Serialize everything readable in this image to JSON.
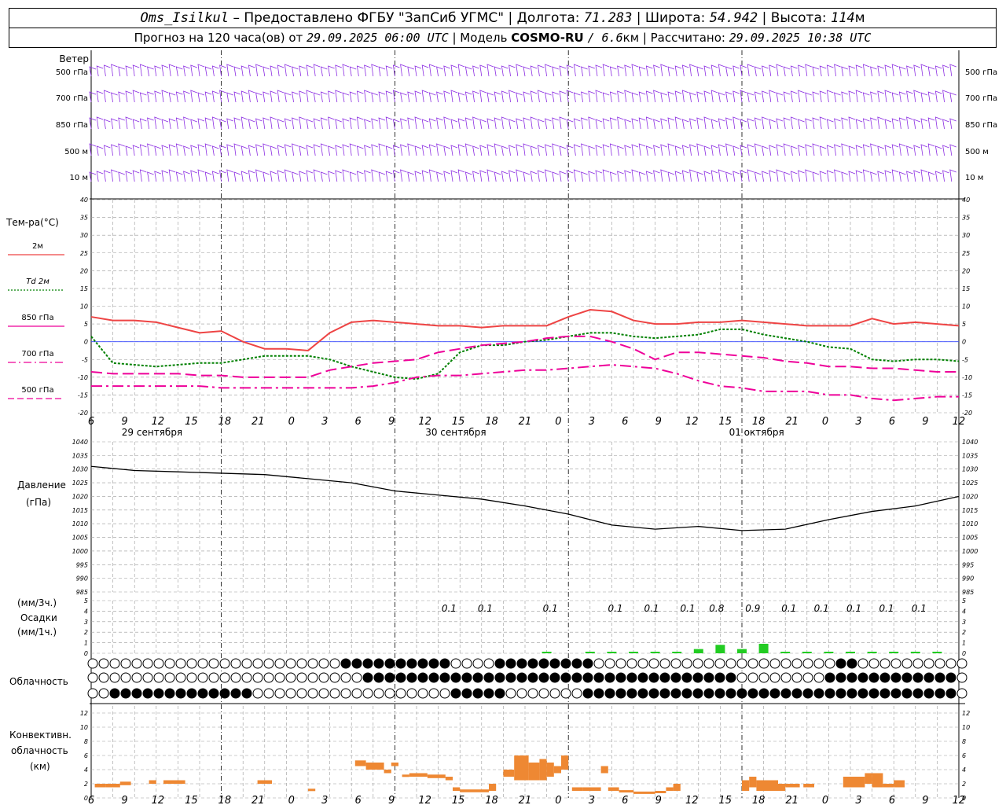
{
  "header": {
    "station": "Oms_Isilkul",
    "provided_by": "– Предоставлено ФГБУ \"ЗапСиб УГМС\"",
    "lon_label": "| Долгота:",
    "lon": "71.283",
    "lat_label": "| Широта:",
    "lat": "54.942",
    "alt_label": "| Высота:",
    "alt": "114",
    "alt_unit": "м",
    "forecast_label": "Прогноз на 120 часа(ов) от",
    "forecast_start": "29.09.2025 06:00 UTC",
    "model_label": "| Модель",
    "model": "COSMO-RU",
    "resolution": "/ 6.6",
    "res_unit": "км",
    "calc_label": "| Рассчитано:",
    "calc_time": "29.09.2025 10:38 UTC"
  },
  "wind": {
    "title": "Ветер",
    "levels": [
      "500 гПа",
      "700 гПа",
      "850 гПа",
      "500 м",
      "10 м"
    ],
    "color": "#8a2be2"
  },
  "temperature": {
    "title": "Тем-ра(°C)",
    "legend": [
      {
        "label": "2м",
        "color": "#ee4444",
        "style": "solid"
      },
      {
        "label": "Td 2м",
        "color": "#008000",
        "style": "dotted"
      },
      {
        "label": "850 гПа",
        "color": "#ee0099",
        "style": "solid"
      },
      {
        "label": "700 гПа",
        "color": "#ee0099",
        "style": "dashdot"
      },
      {
        "label": "500 гПа",
        "color": "#ee0099",
        "style": "dashed"
      }
    ],
    "y_ticks": [
      "40",
      "35",
      "30",
      "25",
      "20",
      "15",
      "10",
      "5",
      "0",
      "-5",
      "-10",
      "-15",
      "-20"
    ]
  },
  "time_axis": {
    "hour_labels": [
      "6",
      "9",
      "12",
      "15",
      "18",
      "21",
      "0",
      "3",
      "6",
      "9",
      "12",
      "15",
      "18",
      "21",
      "0",
      "3",
      "6",
      "9",
      "12",
      "15",
      "18",
      "21",
      "0",
      "3",
      "6",
      "9",
      "12"
    ],
    "dates": [
      "29 сентября",
      "30 сентября",
      "01 октября"
    ]
  },
  "pressure": {
    "title": "Давление",
    "unit": "(гПа)",
    "y_ticks": [
      "1040",
      "1035",
      "1030",
      "1025",
      "1020",
      "1015",
      "1010",
      "1005",
      "1000",
      "995",
      "990",
      "985"
    ]
  },
  "precip": {
    "unit3": "(мм/3ч.)",
    "title": "Осадки",
    "unit1": "(мм/1ч.)",
    "y_ticks": [
      "5",
      "4",
      "3",
      "2",
      "1",
      "0"
    ],
    "labels": [
      "0.1",
      "0.1",
      "0.1",
      "0.1",
      "0.1",
      "0.1",
      "0.8",
      "0.9",
      "0.1",
      "0.1",
      "0.1",
      "0.1",
      "0.1"
    ]
  },
  "cloud": {
    "title": "Облачность"
  },
  "convective": {
    "title_1": "Конвективн.",
    "title_2": "облачность",
    "unit": "(км)",
    "y_ticks": [
      "12",
      "10",
      "8",
      "6",
      "4",
      "2",
      "0"
    ]
  },
  "chart_data": [
    {
      "type": "line",
      "title": "Тем-ра(°C)",
      "x_hours_from_start": [
        0,
        3,
        6,
        9,
        12,
        15,
        18,
        21,
        24,
        27,
        30,
        33,
        36,
        39,
        42,
        45,
        48,
        51,
        54,
        57,
        60,
        63,
        66,
        69,
        72,
        75,
        78,
        81,
        84,
        87,
        90,
        93,
        96,
        99,
        102,
        105,
        108,
        111,
        114,
        117,
        120
      ],
      "ylim": [
        -20,
        40
      ],
      "series": [
        {
          "name": "2м",
          "values": [
            7,
            6,
            6,
            5.5,
            4,
            2.5,
            3,
            0,
            -2,
            -2,
            -2.5,
            2.5,
            5.5,
            6,
            5.5,
            5,
            4.5,
            4.5,
            4,
            4.5,
            4.5,
            4.5,
            7,
            9,
            8.5,
            6,
            5,
            5,
            5.5,
            5.5,
            6,
            5.5,
            5,
            4.5,
            4.5,
            4.5,
            6.5,
            5,
            5.5,
            5,
            4.5
          ]
        },
        {
          "name": "Td 2м",
          "values": [
            1.5,
            -6,
            -6.5,
            -7,
            -6.5,
            -6,
            -6,
            -5,
            -4,
            -4,
            -4,
            -5,
            -7,
            -8.5,
            -10,
            -10.5,
            -9,
            -3,
            -1,
            -1,
            0,
            0.5,
            1.5,
            2.5,
            2.5,
            1.5,
            1,
            1.5,
            2,
            3.5,
            3.5,
            2,
            1,
            0,
            -1.5,
            -2,
            -5,
            -5.5,
            -5,
            -5,
            -5.5
          ]
        },
        {
          "name": "850 гПа",
          "values": [
            -8.5,
            -9,
            -9,
            -9,
            -9,
            -9.5,
            -9.5,
            -10,
            -10,
            -10,
            -10,
            -8,
            -7,
            -6,
            -5.5,
            -5,
            -3,
            -2,
            -1,
            -0.5,
            0,
            1,
            1.5,
            1.5,
            0,
            -2,
            -5,
            -3,
            -3,
            -3.5,
            -4,
            -4.5,
            -5.5,
            -6,
            -7,
            -7,
            -7.5,
            -7.5,
            -8,
            -8.5,
            -8.5
          ]
        },
        {
          "name": "700 гПа",
          "values": [
            -12.5,
            -12.5,
            -12.5,
            -12.5,
            -12.5,
            -12.5,
            -13,
            -13,
            -13,
            -13,
            -13,
            -13,
            -13,
            -12.5,
            -11.5,
            -10,
            -9.5,
            -9.5,
            -9,
            -8.5,
            -8,
            -8,
            -7.5,
            -7,
            -6.5,
            -7,
            -7.5,
            -9,
            -11,
            -12.5,
            -13,
            -14,
            -14,
            -14,
            -15,
            -15,
            -16,
            -16.5,
            -16,
            -15.5,
            -15.5
          ]
        }
      ]
    },
    {
      "type": "line",
      "title": "Давление",
      "x_hours_from_start": [
        0,
        6,
        12,
        18,
        24,
        30,
        36,
        42,
        48,
        54,
        60,
        66,
        72,
        78,
        84,
        90,
        96,
        102,
        108,
        114,
        120
      ],
      "ylim": [
        985,
        1040
      ],
      "series": [
        {
          "name": "Давление",
          "values": [
            1031,
            1029.5,
            1029,
            1028.5,
            1028,
            1026.5,
            1025,
            1022,
            1020.5,
            1019,
            1016.5,
            1013.5,
            1009.5,
            1008,
            1009,
            1007.5,
            1008,
            1011.5,
            1014.5,
            1016.5,
            1020
          ]
        }
      ]
    },
    {
      "type": "bar",
      "title": "Осадки",
      "x_hours_from_start": [
        63,
        66,
        69,
        72,
        75,
        78,
        81,
        84,
        87,
        90,
        93,
        96,
        99,
        102,
        105,
        108,
        111,
        114,
        117
      ],
      "ylim": [
        0,
        5
      ],
      "series": [
        {
          "name": "мм/1ч",
          "values": [
            0.1,
            0,
            0.1,
            0.1,
            0.1,
            0.1,
            0.1,
            0.4,
            0.8,
            0.4,
            0.9,
            0.1,
            0.1,
            0.1,
            0.1,
            0.1,
            0.1,
            0.1,
            0.1
          ]
        }
      ]
    },
    {
      "type": "bar",
      "title": "Конвективн. облачность (км)",
      "ylim": [
        0,
        13
      ],
      "segments": [
        {
          "x0": 0.5,
          "x1": 2,
          "base": 1.5,
          "top": 2
        },
        {
          "x0": 2,
          "x1": 4,
          "base": 1.5,
          "top": 2
        },
        {
          "x0": 4,
          "x1": 5.5,
          "base": 1.8,
          "top": 2.3
        },
        {
          "x0": 8,
          "x1": 9,
          "base": 2,
          "top": 2.5
        },
        {
          "x0": 10,
          "x1": 13,
          "base": 2,
          "top": 2.5
        },
        {
          "x0": 23,
          "x1": 25,
          "base": 2,
          "top": 2.5
        },
        {
          "x0": 30,
          "x1": 31,
          "base": 1,
          "top": 1.3
        },
        {
          "x0": 36.5,
          "x1": 38,
          "base": 4.5,
          "top": 5.3
        },
        {
          "x0": 38,
          "x1": 40.5,
          "base": 4,
          "top": 5
        },
        {
          "x0": 40.5,
          "x1": 41.5,
          "base": 3.5,
          "top": 4
        },
        {
          "x0": 41.5,
          "x1": 42.5,
          "base": 4.5,
          "top": 5
        },
        {
          "x0": 43,
          "x1": 44,
          "base": 3,
          "top": 3.3
        },
        {
          "x0": 44,
          "x1": 46.5,
          "base": 3,
          "top": 3.5
        },
        {
          "x0": 46.5,
          "x1": 49,
          "base": 2.8,
          "top": 3.3
        },
        {
          "x0": 49,
          "x1": 50,
          "base": 2.5,
          "top": 3
        },
        {
          "x0": 50,
          "x1": 51,
          "base": 1,
          "top": 1.5
        },
        {
          "x0": 51,
          "x1": 55,
          "base": 0.8,
          "top": 1.2
        },
        {
          "x0": 55,
          "x1": 56,
          "base": 1,
          "top": 2
        },
        {
          "x0": 57,
          "x1": 58.5,
          "base": 3,
          "top": 4
        },
        {
          "x0": 58.5,
          "x1": 60.5,
          "base": 2.5,
          "top": 6
        },
        {
          "x0": 60.5,
          "x1": 62,
          "base": 2.5,
          "top": 5
        },
        {
          "x0": 62,
          "x1": 63,
          "base": 2.5,
          "top": 5.5
        },
        {
          "x0": 63,
          "x1": 64,
          "base": 3,
          "top": 5
        },
        {
          "x0": 64,
          "x1": 65,
          "base": 3.5,
          "top": 4.5
        },
        {
          "x0": 65,
          "x1": 66,
          "base": 4,
          "top": 6
        },
        {
          "x0": 66.5,
          "x1": 68,
          "base": 1,
          "top": 1.5
        },
        {
          "x0": 68,
          "x1": 70.5,
          "base": 1,
          "top": 1.5
        },
        {
          "x0": 70.5,
          "x1": 71.5,
          "base": 3.5,
          "top": 4.5
        },
        {
          "x0": 71.5,
          "x1": 73,
          "base": 1,
          "top": 1.5
        },
        {
          "x0": 73,
          "x1": 75,
          "base": 0.8,
          "top": 1.1
        },
        {
          "x0": 75,
          "x1": 78,
          "base": 0.6,
          "top": 0.9
        },
        {
          "x0": 78,
          "x1": 79.5,
          "base": 0.7,
          "top": 1
        },
        {
          "x0": 79.5,
          "x1": 80.5,
          "base": 1,
          "top": 1.5
        },
        {
          "x0": 80.5,
          "x1": 81.5,
          "base": 1,
          "top": 2
        },
        {
          "x0": 90,
          "x1": 91,
          "base": 1,
          "top": 2.5
        },
        {
          "x0": 91,
          "x1": 92,
          "base": 1.5,
          "top": 3
        },
        {
          "x0": 92,
          "x1": 95,
          "base": 1,
          "top": 2.5
        },
        {
          "x0": 95,
          "x1": 96,
          "base": 1,
          "top": 2
        },
        {
          "x0": 96,
          "x1": 98,
          "base": 1.5,
          "top": 2
        },
        {
          "x0": 98.5,
          "x1": 100,
          "base": 1.5,
          "top": 2
        },
        {
          "x0": 104,
          "x1": 107,
          "base": 1.5,
          "top": 3
        },
        {
          "x0": 107,
          "x1": 108,
          "base": 2,
          "top": 3.5
        },
        {
          "x0": 108,
          "x1": 109.5,
          "base": 1.5,
          "top": 3.5
        },
        {
          "x0": 109.5,
          "x1": 111,
          "base": 1.5,
          "top": 2
        },
        {
          "x0": 111,
          "x1": 112.5,
          "base": 1.5,
          "top": 2.5
        }
      ]
    }
  ]
}
